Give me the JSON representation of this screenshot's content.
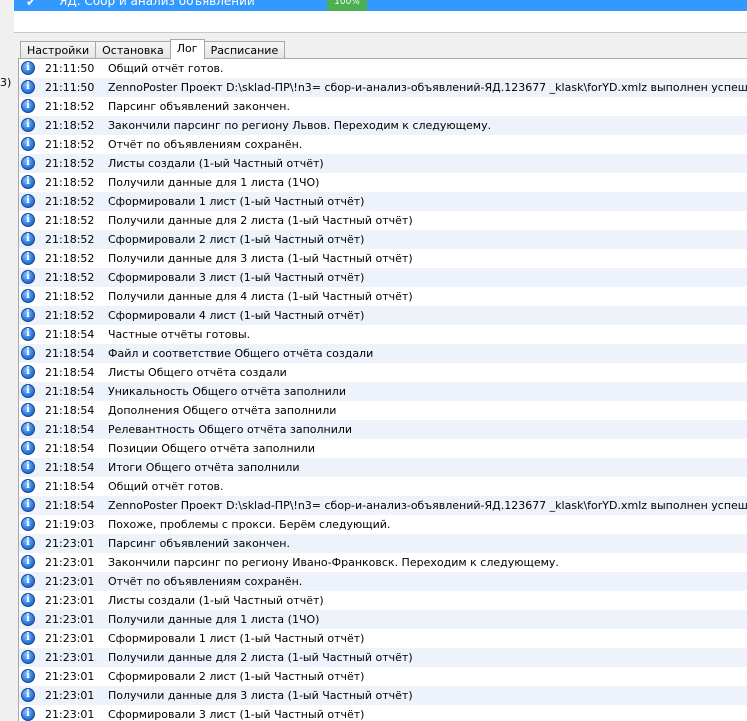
{
  "header": {
    "row_title": "ЯД. Сбор и анализ объявлений",
    "progress": "100%",
    "gutter_label": "3)"
  },
  "tabs": [
    {
      "label": "Настройки",
      "active": false
    },
    {
      "label": "Остановка",
      "active": false
    },
    {
      "label": "Лог",
      "active": true
    },
    {
      "label": "Расписание",
      "active": false
    }
  ],
  "log": [
    {
      "time": "21:11:50",
      "msg": "Общий отчёт готов."
    },
    {
      "time": "21:11:50",
      "msg": "ZennoPoster Проект D:\\sklad-ПР\\!n3= сбор-и-анализ-объявлений-ЯД.123677 _klask\\forYD.xmlz выполнен успешно!"
    },
    {
      "time": "21:18:52",
      "msg": "Парсинг объявлений закончен."
    },
    {
      "time": "21:18:52",
      "msg": "Закончили парсинг по региону Львов. Переходим к следующему."
    },
    {
      "time": "21:18:52",
      "msg": "Отчёт по объявлениям сохранён."
    },
    {
      "time": "21:18:52",
      "msg": "Листы создали (1-ый Частный отчёт)"
    },
    {
      "time": "21:18:52",
      "msg": "Получили данные для 1 листа (1ЧО)"
    },
    {
      "time": "21:18:52",
      "msg": "Сформировали 1 лист (1-ый Частный отчёт)"
    },
    {
      "time": "21:18:52",
      "msg": "Получили данные для 2 листа (1-ый Частный отчёт)"
    },
    {
      "time": "21:18:52",
      "msg": "Сформировали 2 лист (1-ый Частный отчёт)"
    },
    {
      "time": "21:18:52",
      "msg": "Получили данные для 3 листа (1-ый Частный отчёт)"
    },
    {
      "time": "21:18:52",
      "msg": "Сформировали 3 лист (1-ый Частный отчёт)"
    },
    {
      "time": "21:18:52",
      "msg": "Получили данные для 4 листа (1-ый Частный отчёт)"
    },
    {
      "time": "21:18:52",
      "msg": "Сформировали 4 лист (1-ый Частный отчёт)"
    },
    {
      "time": "21:18:54",
      "msg": "Частные отчёты готовы."
    },
    {
      "time": "21:18:54",
      "msg": "Файл и соответствие Общего отчёта создали"
    },
    {
      "time": "21:18:54",
      "msg": "Листы Общего отчёта создали"
    },
    {
      "time": "21:18:54",
      "msg": "Уникальность Общего отчёта заполнили"
    },
    {
      "time": "21:18:54",
      "msg": "Дополнения Общего отчёта заполнили"
    },
    {
      "time": "21:18:54",
      "msg": "Релевантность Общего отчёта заполнили"
    },
    {
      "time": "21:18:54",
      "msg": "Позиции Общего отчёта заполнили"
    },
    {
      "time": "21:18:54",
      "msg": "Итоги Общего отчёта заполнили"
    },
    {
      "time": "21:18:54",
      "msg": "Общий отчёт готов."
    },
    {
      "time": "21:18:54",
      "msg": "ZennoPoster Проект D:\\sklad-ПР\\!n3= сбор-и-анализ-объявлений-ЯД.123677 _klask\\forYD.xmlz выполнен успешно!"
    },
    {
      "time": "21:19:03",
      "msg": "Похоже, проблемы с прокси. Берём следующий."
    },
    {
      "time": "21:23:01",
      "msg": "Парсинг объявлений закончен."
    },
    {
      "time": "21:23:01",
      "msg": "Закончили парсинг по региону Ивано-Франковск. Переходим к следующему."
    },
    {
      "time": "21:23:01",
      "msg": "Отчёт по объявлениям сохранён."
    },
    {
      "time": "21:23:01",
      "msg": "Листы создали (1-ый Частный отчёт)"
    },
    {
      "time": "21:23:01",
      "msg": "Получили данные для 1 листа (1ЧО)"
    },
    {
      "time": "21:23:01",
      "msg": "Сформировали 1 лист (1-ый Частный отчёт)"
    },
    {
      "time": "21:23:01",
      "msg": "Получили данные для 2 листа (1-ый Частный отчёт)"
    },
    {
      "time": "21:23:01",
      "msg": "Сформировали 2 лист (1-ый Частный отчёт)"
    },
    {
      "time": "21:23:01",
      "msg": "Получили данные для 3 листа (1-ый Частный отчёт)"
    },
    {
      "time": "21:23:01",
      "msg": "Сформировали 3 лист (1-ый Частный отчёт)"
    }
  ]
}
